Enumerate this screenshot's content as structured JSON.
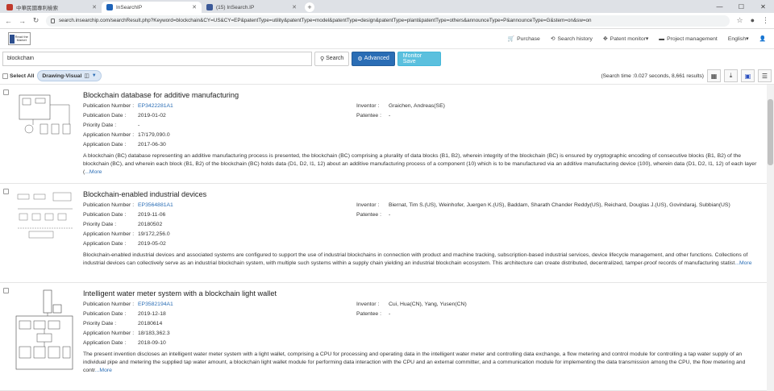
{
  "browser": {
    "tabs": [
      {
        "title": "中華民國專利檢索",
        "color": "#c0392b",
        "active": false
      },
      {
        "title": "InSearchIP",
        "color": "#1e63b8",
        "active": true
      },
      {
        "title": "(15) InSearch.IP",
        "color": "#3b5998",
        "active": false
      }
    ],
    "url": "search.insearchip.com/searchResult.php?Keyword=blockchain&CY=US&CY=EP&patentType=utility&patentType=model&patentType=design&patentType=plant&patentType=others&announceType=P&announceType=G&stem=on&sw=on"
  },
  "site": {
    "logo_text": "Read the Market",
    "nav": [
      {
        "icon": "cart-icon",
        "glyph": "🛒",
        "label": "Purchase"
      },
      {
        "icon": "history-icon",
        "glyph": "⟲",
        "label": "Search history"
      },
      {
        "icon": "monitor-icon",
        "glyph": "✥",
        "label": "Patent monitor▾"
      },
      {
        "icon": "folder-icon",
        "glyph": "▬",
        "label": "Project management"
      },
      {
        "icon": "",
        "glyph": "",
        "label": "English▾"
      },
      {
        "icon": "user-icon",
        "glyph": "👤",
        "label": ""
      }
    ]
  },
  "search": {
    "value": "blockchain",
    "search_label": "Search",
    "advanced_label": "Advanced",
    "monitor_label": "Monitor Save"
  },
  "toolbar": {
    "select_all": "Select All",
    "drawing_visual": "Drawing-Visual",
    "stats": "(Search time :0.027 seconds, 8,661 results)"
  },
  "labels": {
    "pub_number": "Publication Number :",
    "pub_date": "Publication Date :",
    "priority_date": "Priority Date :",
    "app_number": "Application Number :",
    "app_date": "Application Date :",
    "inventor": "Inventor :",
    "patentee": "Patentee :",
    "more": "...More"
  },
  "results": [
    {
      "title": "Blockchain database for additive manufacturing",
      "pub_number": "EP3422281A1",
      "pub_date": "2019-01-02",
      "priority_date": "-",
      "app_number": "17/179,090.0",
      "app_date": "2017-06-30",
      "inventor": "Graichen, Andreas(SE)",
      "patentee": "-",
      "abstract": "A blockchain (BC) database representing an additive manufacturing process is presented, the blockchain (BC) comprising a plurality of data blocks (B1, B2), wherein integrity of the blockchain (BC) is ensured by cryptographic encoding of consecutive blocks (B1, B2) of the blockchain (BC), and wherein each block (B1, B2) of the blockchain (BC) holds data (D1, D2, I1, 12) about an additive manufacturing process of a component (10) which is to be manufactured via an additive manufacturing device (100), wherein data (D1, D2, I1, 12) of each layer (",
      "more": "...More"
    },
    {
      "title": "Blockchain-enabled industrial devices",
      "pub_number": "EP3564881A1",
      "pub_date": "2019-11-06",
      "priority_date": "20180502",
      "app_number": "19/172,256.0",
      "app_date": "2019-05-02",
      "inventor": "Biernat, Tim S.(US), Weinhofer, Juergen K.(US), Baddam, Sharath Chander Reddy(US), Reichard, Douglas J.(US), Govindaraj, Subbian(US)",
      "patentee": "-",
      "abstract": "Blockchain-enabled industrial devices and associated systems are configured to support the use of industrial blockchains in connection with product and machine tracking, subscription-based industrial services, device lifecycle management, and other functions. Collections of industrial devices can collectively serve as an industrial blockchain system, with multiple such systems within a supply chain yielding an industrial blockchain ecosystem. This architecture can create distributed, decentralized, tamper-proof records of manufacturing statist",
      "more": "...More"
    },
    {
      "title": "Intelligent water meter system with a blockchain light wallet",
      "pub_number": "EP3582194A1",
      "pub_date": "2019-12-18",
      "priority_date": "20180614",
      "app_number": "18/183,362.3",
      "app_date": "2018-09-10",
      "inventor": "Cui, Hua(CN), Yang, Yusen(CN)",
      "patentee": "-",
      "abstract": "The present invention discloses an intelligent water meter system with a light wallet, comprising a CPU for processing and operating data in the intelligent water meter and controlling data exchange, a flow metering and control module for controlling a tap water supply of an individual pipe and metering the supplied tap water amount, a blockchain light wallet module for performing data interaction with the CPU and an external committer, and a communication module for implementing the data transmission among the CPU, the flow metering and contr",
      "more": "...More"
    }
  ]
}
